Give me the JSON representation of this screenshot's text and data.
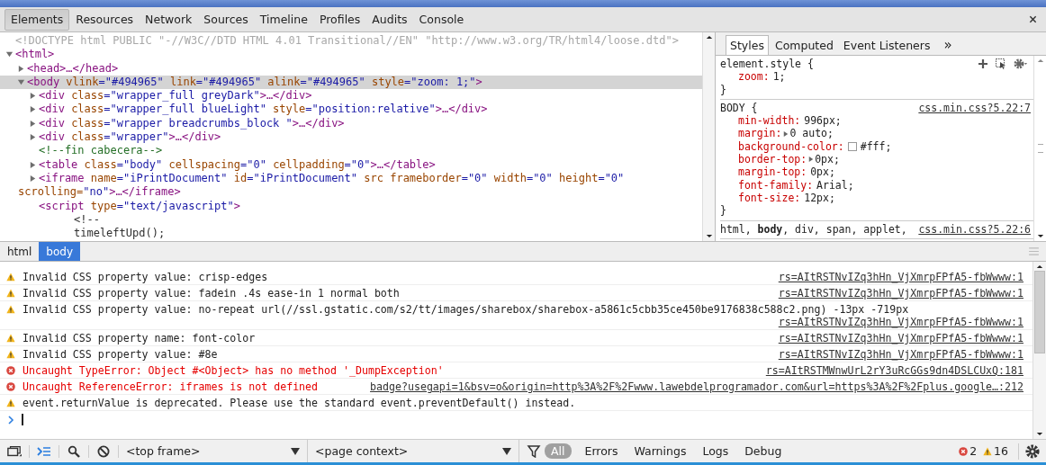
{
  "toolbar_tabs": [
    {
      "label": "Elements",
      "selected": true
    },
    {
      "label": "Resources",
      "selected": false
    },
    {
      "label": "Network",
      "selected": false
    },
    {
      "label": "Sources",
      "selected": false
    },
    {
      "label": "Timeline",
      "selected": false
    },
    {
      "label": "Profiles",
      "selected": false
    },
    {
      "label": "Audits",
      "selected": false
    },
    {
      "label": "Console",
      "selected": false
    }
  ],
  "elements_tree": [
    {
      "kind": "doctype",
      "selected": false,
      "tokens": [
        {
          "kind": "doctype",
          "text": "<!DOCTYPE html PUBLIC \"-//W3C//DTD HTML 4.01 Transitional//EN\" \"http://www.w3.org/TR/html4/loose.dtd\">"
        }
      ]
    },
    {
      "kind": "element",
      "selected": false,
      "expanded": true,
      "tokens": [
        {
          "kind": "tag",
          "text": "<html>"
        }
      ],
      "children": [
        {
          "kind": "element",
          "selected": false,
          "expanded": false,
          "tokens": [
            {
              "kind": "tag",
              "text": "<head>…</head>"
            }
          ]
        },
        {
          "kind": "element",
          "selected": true,
          "expanded": true,
          "tokens": [
            {
              "kind": "tag",
              "text": "<body"
            },
            {
              "kind": "attr-name",
              "text": " vlink"
            },
            {
              "kind": "attr-value",
              "text": "=\"#494965\""
            },
            {
              "kind": "attr-name",
              "text": " link"
            },
            {
              "kind": "attr-value",
              "text": "=\"#494965\""
            },
            {
              "kind": "attr-name",
              "text": " alink"
            },
            {
              "kind": "attr-value",
              "text": "=\"#494965\""
            },
            {
              "kind": "attr-name",
              "text": " style"
            },
            {
              "kind": "attr-value",
              "text": "=\"zoom: 1;\""
            },
            {
              "kind": "tag",
              "text": ">"
            }
          ],
          "children": [
            {
              "kind": "element",
              "selected": false,
              "expanded": false,
              "tokens": [
                {
                  "kind": "tag",
                  "text": "<div"
                },
                {
                  "kind": "attr-name",
                  "text": " class"
                },
                {
                  "kind": "attr-value",
                  "text": "=\"wrapper_full greyDark\""
                },
                {
                  "kind": "tag",
                  "text": ">…</div>"
                }
              ]
            },
            {
              "kind": "element",
              "selected": false,
              "expanded": false,
              "tokens": [
                {
                  "kind": "tag",
                  "text": "<div"
                },
                {
                  "kind": "attr-name",
                  "text": " class"
                },
                {
                  "kind": "attr-value",
                  "text": "=\"wrapper_full blueLight\""
                },
                {
                  "kind": "attr-name",
                  "text": " style"
                },
                {
                  "kind": "attr-value",
                  "text": "=\"position:relative\""
                },
                {
                  "kind": "tag",
                  "text": ">…</div>"
                }
              ]
            },
            {
              "kind": "element",
              "selected": false,
              "expanded": false,
              "tokens": [
                {
                  "kind": "tag",
                  "text": "<div"
                },
                {
                  "kind": "attr-name",
                  "text": " class"
                },
                {
                  "kind": "attr-value",
                  "text": "=\"wrapper breadcrumbs_block \""
                },
                {
                  "kind": "tag",
                  "text": ">…</div>"
                }
              ]
            },
            {
              "kind": "element",
              "selected": false,
              "expanded": false,
              "tokens": [
                {
                  "kind": "tag",
                  "text": "<div"
                },
                {
                  "kind": "attr-name",
                  "text": " class"
                },
                {
                  "kind": "attr-value",
                  "text": "=\"wrapper\""
                },
                {
                  "kind": "tag",
                  "text": ">…</div>"
                }
              ]
            },
            {
              "kind": "comment",
              "selected": false,
              "tokens": [
                {
                  "kind": "comment",
                  "text": "<!--fin cabecera-->"
                }
              ]
            },
            {
              "kind": "element",
              "selected": false,
              "expanded": false,
              "tokens": [
                {
                  "kind": "tag",
                  "text": "<table"
                },
                {
                  "kind": "attr-name",
                  "text": " class"
                },
                {
                  "kind": "attr-value",
                  "text": "=\"body\""
                },
                {
                  "kind": "attr-name",
                  "text": " cellspacing"
                },
                {
                  "kind": "attr-value",
                  "text": "=\"0\""
                },
                {
                  "kind": "attr-name",
                  "text": " cellpadding"
                },
                {
                  "kind": "attr-value",
                  "text": "=\"0\""
                },
                {
                  "kind": "tag",
                  "text": ">…</table>"
                }
              ]
            },
            {
              "kind": "element",
              "selected": false,
              "expanded": false,
              "tokens": [
                {
                  "kind": "tag",
                  "text": "<iframe"
                },
                {
                  "kind": "attr-name",
                  "text": " name"
                },
                {
                  "kind": "attr-value",
                  "text": "=\"iPrintDocument\""
                },
                {
                  "kind": "attr-name",
                  "text": " id"
                },
                {
                  "kind": "attr-value",
                  "text": "=\"iPrintDocument\""
                },
                {
                  "kind": "attr-name",
                  "text": " src"
                },
                {
                  "kind": "attr-name",
                  "text": " frameborder"
                },
                {
                  "kind": "attr-value",
                  "text": "=\"0\""
                },
                {
                  "kind": "attr-name",
                  "text": " width"
                },
                {
                  "kind": "attr-value",
                  "text": "=\"0\""
                },
                {
                  "kind": "attr-name",
                  "text": " height"
                },
                {
                  "kind": "attr-value",
                  "text": "=\"0\""
                },
                {
                  "kind": "attr-name",
                  "text": " scrolling="
                },
                {
                  "kind": "attr-value",
                  "text": "\"no\""
                },
                {
                  "kind": "tag",
                  "text": ">…</iframe>"
                }
              ]
            },
            {
              "kind": "script",
              "selected": false,
              "tokens": [
                {
                  "kind": "tag",
                  "text": "<script"
                },
                {
                  "kind": "attr-name",
                  "text": " type"
                },
                {
                  "kind": "attr-value",
                  "text": "=\"text/javascript\""
                },
                {
                  "kind": "tag",
                  "text": ">"
                }
              ],
              "children": [
                {
                  "kind": "text",
                  "selected": false,
                  "tokens": [
                    {
                      "kind": "text",
                      "text": "<!--"
                    }
                  ]
                },
                {
                  "kind": "text",
                  "selected": false,
                  "tokens": [
                    {
                      "kind": "text",
                      "text": "timeleftUpd();"
                    }
                  ]
                }
              ]
            }
          ]
        }
      ]
    }
  ],
  "styles_panel": {
    "tabs": [
      {
        "label": "Styles",
        "selected": true
      },
      {
        "label": "Computed",
        "selected": false
      },
      {
        "label": "Event Listeners",
        "selected": false
      }
    ],
    "more": "»",
    "rules": [
      {
        "kind": "inline",
        "selector": "element.style {",
        "properties": [
          {
            "name": "zoom:",
            "value": "1;",
            "expandable": false
          }
        ],
        "close": "}"
      },
      {
        "kind": "matched",
        "selector": "BODY {",
        "source": "css.min.css?5.22:7",
        "properties": [
          {
            "name": "min-width:",
            "value": "996px;",
            "expandable": false
          },
          {
            "name": "margin:",
            "value": "0 auto;",
            "expandable": true
          },
          {
            "name": "background-color:",
            "value": "#fff;",
            "expandable": false,
            "color": "#ffffff"
          },
          {
            "name": "border-top:",
            "value": "0px;",
            "expandable": true
          },
          {
            "name": "margin-top:",
            "value": "0px;",
            "expandable": false
          },
          {
            "name": "font-family:",
            "value": "Arial;",
            "expandable": false
          },
          {
            "name": "font-size:",
            "value": "12px;",
            "expandable": false
          }
        ],
        "close": "}"
      },
      {
        "kind": "matched",
        "selector": "html, **body**, div, span, applet,",
        "source": "css.min.css?5.22:6"
      }
    ]
  },
  "breadcrumbs": [
    {
      "label": "html",
      "selected": false
    },
    {
      "label": "body",
      "selected": true
    }
  ],
  "console": {
    "messages": [
      {
        "kind": "warning",
        "text": "Invalid CSS property value: crisp-edges",
        "source": "rs=AItRSTNvIZq3hHn_VjXmrpFPfA5-fbWwww:1"
      },
      {
        "kind": "warning",
        "text": "Invalid CSS property value: fadein .4s ease-in 1 normal both",
        "source": "rs=AItRSTNvIZq3hHn_VjXmrpFPfA5-fbWwww:1"
      },
      {
        "kind": "warning",
        "text": "Invalid CSS property value: no-repeat url(//ssl.gstatic.com/s2/tt/images/sharebox/sharebox-a5861c5cbb35ce450be9176838c588c2.png) -13px -719px",
        "source": "rs=AItRSTNvIZq3hHn_VjXmrpFPfA5-fbWwww:1"
      },
      {
        "kind": "warning",
        "text": "Invalid CSS property name: font-color",
        "source": "rs=AItRSTNvIZq3hHn_VjXmrpFPfA5-fbWwww:1"
      },
      {
        "kind": "warning",
        "text": "Invalid CSS property value: #8e",
        "source": "rs=AItRSTNvIZq3hHn_VjXmrpFPfA5-fbWwww:1"
      },
      {
        "kind": "error",
        "text": "Uncaught TypeError: Object #<Object> has no method '_DumpException'",
        "source": "rs=AItRSTMWnwUrL2rY3uRcGGs9dn4DSLCUxQ:181"
      },
      {
        "kind": "error",
        "text": "Uncaught ReferenceError: iframes is not defined",
        "source": "badge?usegapi=1&bsv=o&origin=http%3A%2F%2Fwww.lawebdelprogramador.com&url=https%3A%2F%2Fplus.google…:212"
      },
      {
        "kind": "warning",
        "text": "event.returnValue is deprecated. Please use the standard event.preventDefault() instead."
      }
    ]
  },
  "bottom_bar": {
    "frame_select": "<top frame>",
    "context_select": "<page context>",
    "filters": [
      {
        "label": "All",
        "selected": true
      },
      {
        "label": "Errors",
        "selected": false
      },
      {
        "label": "Warnings",
        "selected": false
      },
      {
        "label": "Logs",
        "selected": false
      },
      {
        "label": "Debug",
        "selected": false
      }
    ],
    "error_count": "2",
    "warning_count": "16"
  }
}
